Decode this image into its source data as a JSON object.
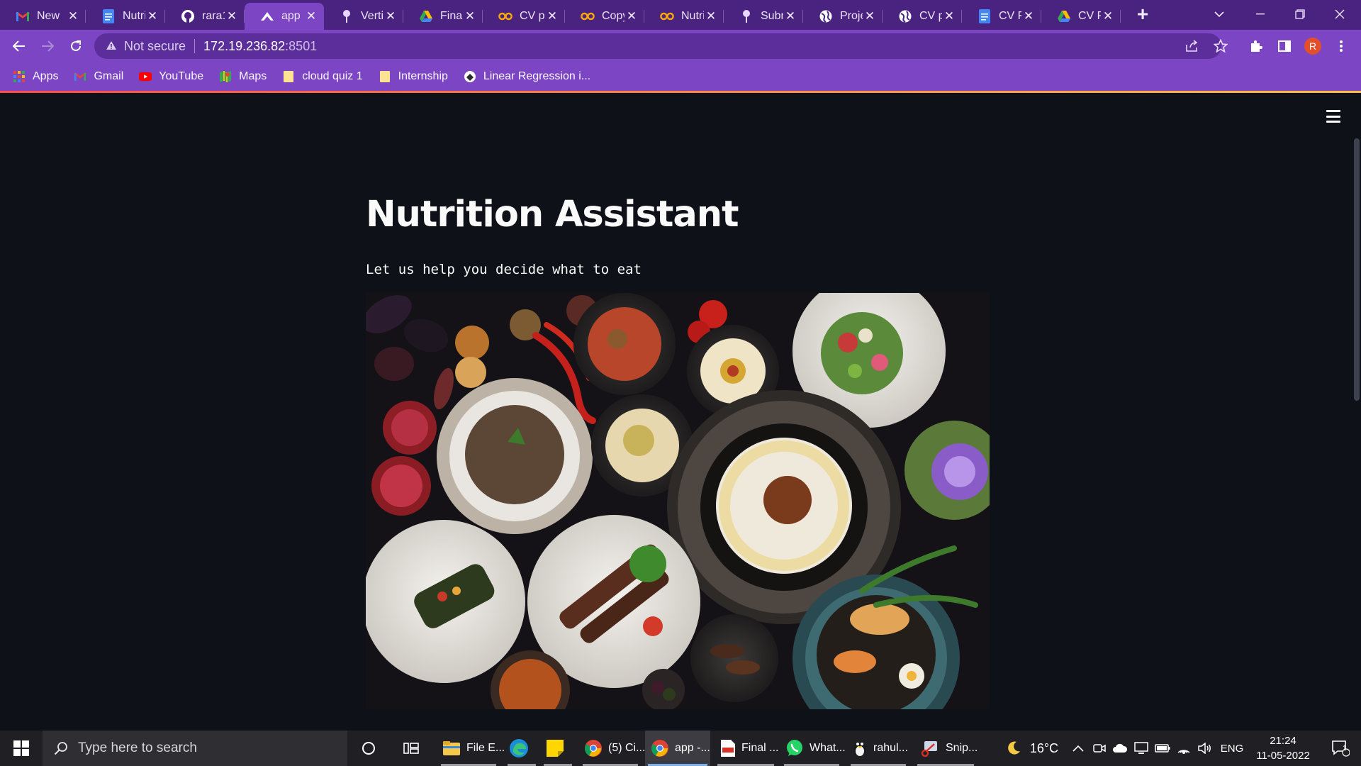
{
  "browser": {
    "tabs": [
      {
        "title": "New",
        "icon": "gmail-icon"
      },
      {
        "title": "Nutri",
        "icon": "google-docs-icon"
      },
      {
        "title": "rara1",
        "icon": "github-icon"
      },
      {
        "title": "app",
        "icon": "streamlit-icon",
        "active": true
      },
      {
        "title": "Verti",
        "icon": "pin-icon"
      },
      {
        "title": "Final",
        "icon": "google-drive-icon"
      },
      {
        "title": "CV p",
        "icon": "colab-icon"
      },
      {
        "title": "Copy",
        "icon": "colab-icon"
      },
      {
        "title": "Nutri",
        "icon": "colab-icon"
      },
      {
        "title": "Subn",
        "icon": "pin-icon"
      },
      {
        "title": "Proje",
        "icon": "globe-icon"
      },
      {
        "title": "CV p",
        "icon": "globe-icon"
      },
      {
        "title": "CV F",
        "icon": "google-docs-icon"
      },
      {
        "title": "CV P",
        "icon": "google-drive-icon"
      }
    ],
    "new_tab_label": "+",
    "address": {
      "security_label": "Not secure",
      "host": "172.19.236.82",
      "port": ":8501"
    },
    "profile_initial": "R",
    "bookmarks": [
      {
        "label": "Apps",
        "icon": "apps-grid-icon"
      },
      {
        "label": "Gmail",
        "icon": "gmail-icon"
      },
      {
        "label": "YouTube",
        "icon": "youtube-icon"
      },
      {
        "label": "Maps",
        "icon": "maps-icon"
      },
      {
        "label": "cloud quiz 1",
        "icon": "folder-icon"
      },
      {
        "label": "Internship",
        "icon": "folder-icon"
      },
      {
        "label": "Linear Regression i...",
        "icon": "site-icon"
      }
    ]
  },
  "app": {
    "title": "Nutrition Assistant",
    "subtitle": "Let us help you decide what to eat",
    "hero_image": "food-spread-image"
  },
  "taskbar": {
    "search_placeholder": "Type here to search",
    "items": [
      {
        "label": "File E...",
        "icon": "file-explorer-icon"
      },
      {
        "label": "",
        "icon": "edge-icon"
      },
      {
        "label": "",
        "icon": "sticky-notes-icon"
      },
      {
        "label": "(5) Ci...",
        "icon": "chrome-icon"
      },
      {
        "label": "app -...",
        "icon": "chrome-icon",
        "active": true
      },
      {
        "label": "Final ...",
        "icon": "pdf-icon"
      },
      {
        "label": "What...",
        "icon": "whatsapp-icon"
      },
      {
        "label": "rahul...",
        "icon": "linux-icon"
      },
      {
        "label": "Snip...",
        "icon": "snip-icon"
      }
    ],
    "weather": "16°C",
    "language": "ENG",
    "time": "21:24",
    "date": "11-05-2022",
    "notification_count": "1"
  },
  "colors": {
    "chrome_frame": "#4a2380",
    "chrome_toolbar": "#7b45c4",
    "app_background": "#0e1117",
    "app_text": "#fafafa",
    "accent_bar_start": "#ff4b4b",
    "accent_bar_end": "#ffbd45"
  }
}
